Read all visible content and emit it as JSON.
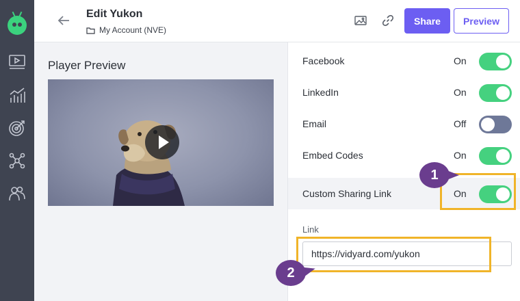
{
  "header": {
    "title": "Edit Yukon",
    "breadcrumb": "My Account (NVE)",
    "share_label": "Share",
    "preview_label": "Preview"
  },
  "player_preview": {
    "title": "Player Preview"
  },
  "sharing": {
    "items": [
      {
        "label": "Facebook",
        "state": "On"
      },
      {
        "label": "LinkedIn",
        "state": "On"
      },
      {
        "label": "Email",
        "state": "Off"
      },
      {
        "label": "Embed Codes",
        "state": "On"
      },
      {
        "label": "Custom Sharing Link",
        "state": "On"
      }
    ],
    "link_label": "Link",
    "link_value": "https://vidyard.com/yukon"
  },
  "annotations": {
    "step1": "1",
    "step2": "2"
  },
  "colors": {
    "accent": "#6c5ef2",
    "toggle_on": "#45d17f",
    "toggle_off": "#6e7898",
    "highlight": "#f0b429",
    "badge": "#6a3d8e",
    "sidebar": "#3f4451",
    "logo": "#3bd27e"
  }
}
